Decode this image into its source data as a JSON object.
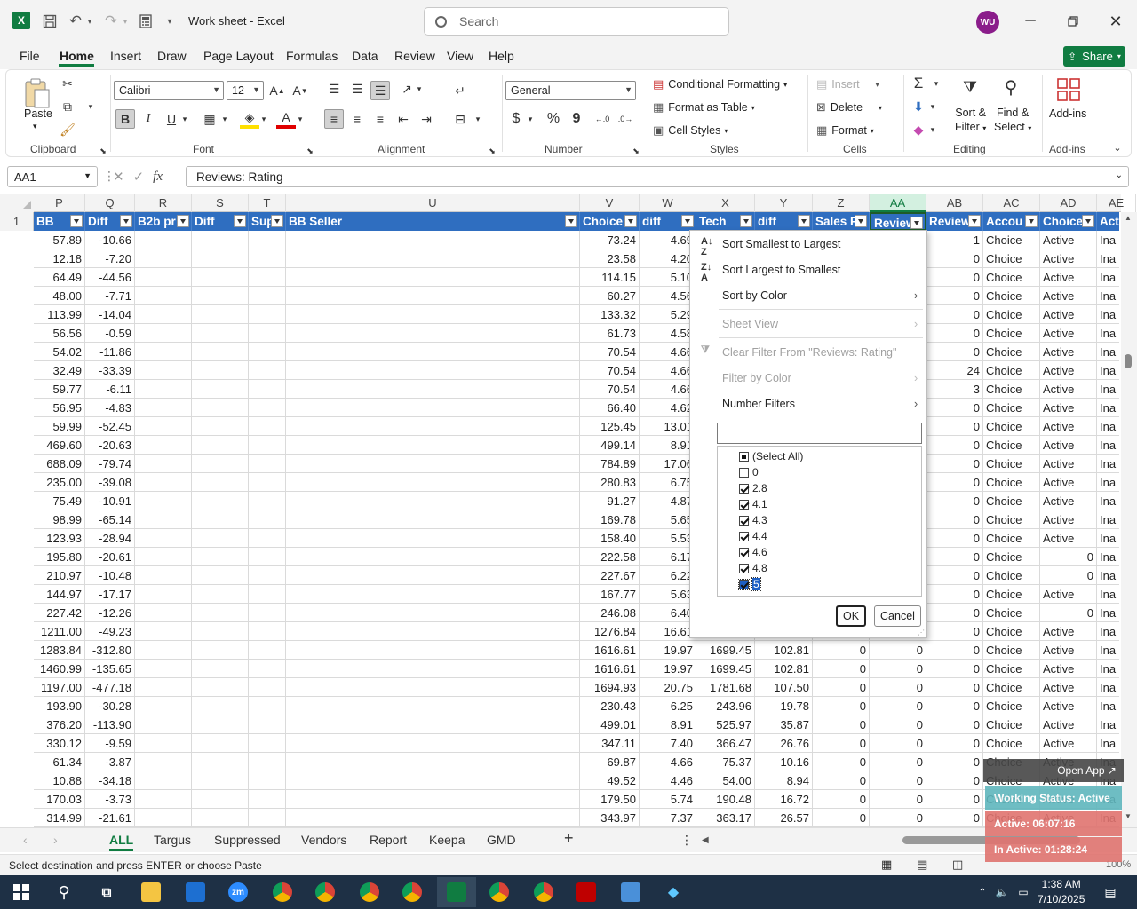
{
  "titlebar": {
    "app_logo": "X",
    "title": "Work sheet  -  Excel",
    "search_placeholder": "Search",
    "avatar": "WU",
    "icons": [
      "save-icon",
      "undo-icon",
      "redo-icon",
      "calculator-icon",
      "customize-icon",
      "minimize-icon",
      "restore-icon",
      "close-icon"
    ]
  },
  "menu": {
    "items": [
      "File",
      "Home",
      "Insert",
      "Draw",
      "Page Layout",
      "Formulas",
      "Data",
      "Review",
      "View",
      "Help"
    ],
    "active": "Home",
    "share": "Share"
  },
  "ribbon": {
    "clipboard": {
      "paste": "Paste",
      "label": "Clipboard"
    },
    "font": {
      "name": "Calibri",
      "size": "12",
      "label": "Font",
      "bold": "B",
      "italic": "I",
      "underline": "U"
    },
    "alignment": {
      "label": "Alignment"
    },
    "number": {
      "format": "General",
      "label": "Number",
      "currency": "$",
      "percent": "%",
      "comma": "9"
    },
    "styles": {
      "conditional": "Conditional Formatting",
      "table": "Format as Table",
      "cell": "Cell Styles",
      "label": "Styles"
    },
    "cells": {
      "insert": "Insert",
      "delete": "Delete",
      "format": "Format",
      "label": "Cells"
    },
    "editing": {
      "sort": "Sort &",
      "sort2": "Filter",
      "find": "Find &",
      "find2": "Select",
      "label": "Editing"
    },
    "addins": {
      "btn": "Add-ins",
      "label": "Add-ins"
    }
  },
  "formula_bar": {
    "name_box": "AA1",
    "formula": "Reviews: Rating",
    "fx": "fx"
  },
  "columns": [
    "P",
    "Q",
    "R",
    "S",
    "T",
    "U",
    "V",
    "W",
    "X",
    "Y",
    "Z",
    "AA",
    "AB",
    "AC",
    "AD",
    "AE"
  ],
  "row1": "1",
  "headers": [
    "BB",
    "Diff",
    "B2b pr",
    "Diff",
    "Sup",
    "BB Seller",
    "Choice",
    "diff",
    "Tech",
    "diff",
    "Sales F",
    "Review",
    "Review",
    "Accou",
    "Choice",
    "Act"
  ],
  "rows": [
    [
      "57.89",
      "-10.66",
      "",
      "",
      "",
      "",
      "73.24",
      "4.69",
      "",
      "",
      "",
      "",
      "1",
      "Choice",
      "Active",
      "Ina"
    ],
    [
      "12.18",
      "-7.20",
      "",
      "",
      "",
      "",
      "23.58",
      "4.20",
      "",
      "",
      "",
      "",
      "0",
      "Choice",
      "Active",
      "Ina"
    ],
    [
      "64.49",
      "-44.56",
      "",
      "",
      "",
      "",
      "114.15",
      "5.10",
      "",
      "",
      "",
      "",
      "0",
      "Choice",
      "Active",
      "Ina"
    ],
    [
      "48.00",
      "-7.71",
      "",
      "",
      "",
      "",
      "60.27",
      "4.56",
      "",
      "",
      "",
      "",
      "0",
      "Choice",
      "Active",
      "Ina"
    ],
    [
      "113.99",
      "-14.04",
      "",
      "",
      "",
      "",
      "133.32",
      "5.29",
      "",
      "",
      "",
      "",
      "0",
      "Choice",
      "Active",
      "Ina"
    ],
    [
      "56.56",
      "-0.59",
      "",
      "",
      "",
      "",
      "61.73",
      "4.58",
      "",
      "",
      "",
      "",
      "0",
      "Choice",
      "Active",
      "Ina"
    ],
    [
      "54.02",
      "-11.86",
      "",
      "",
      "",
      "",
      "70.54",
      "4.66",
      "",
      "",
      "",
      "",
      "0",
      "Choice",
      "Active",
      "Ina"
    ],
    [
      "32.49",
      "-33.39",
      "",
      "",
      "",
      "",
      "70.54",
      "4.66",
      "",
      "",
      "",
      "",
      "24",
      "Choice",
      "Active",
      "Ina"
    ],
    [
      "59.77",
      "-6.11",
      "",
      "",
      "",
      "",
      "70.54",
      "4.66",
      "",
      "",
      "",
      "",
      "3",
      "Choice",
      "Active",
      "Ina"
    ],
    [
      "56.95",
      "-4.83",
      "",
      "",
      "",
      "",
      "66.40",
      "4.62",
      "",
      "",
      "",
      "",
      "0",
      "Choice",
      "Active",
      "Ina"
    ],
    [
      "59.99",
      "-52.45",
      "",
      "",
      "",
      "",
      "125.45",
      "13.01",
      "",
      "",
      "",
      "",
      "0",
      "Choice",
      "Active",
      "Ina"
    ],
    [
      "469.60",
      "-20.63",
      "",
      "",
      "",
      "",
      "499.14",
      "8.91",
      "",
      "",
      "",
      "",
      "0",
      "Choice",
      "Active",
      "Ina"
    ],
    [
      "688.09",
      "-79.74",
      "",
      "",
      "",
      "",
      "784.89",
      "17.06",
      "",
      "",
      "",
      "",
      "0",
      "Choice",
      "Active",
      "Ina"
    ],
    [
      "235.00",
      "-39.08",
      "",
      "",
      "",
      "",
      "280.83",
      "6.75",
      "",
      "",
      "",
      "",
      "0",
      "Choice",
      "Active",
      "Ina"
    ],
    [
      "75.49",
      "-10.91",
      "",
      "",
      "",
      "",
      "91.27",
      "4.87",
      "",
      "",
      "",
      "",
      "0",
      "Choice",
      "Active",
      "Ina"
    ],
    [
      "98.99",
      "-65.14",
      "",
      "",
      "",
      "",
      "169.78",
      "5.65",
      "",
      "",
      "",
      "",
      "0",
      "Choice",
      "Active",
      "Ina"
    ],
    [
      "123.93",
      "-28.94",
      "",
      "",
      "",
      "",
      "158.40",
      "5.53",
      "",
      "",
      "",
      "",
      "0",
      "Choice",
      "Active",
      "Ina"
    ],
    [
      "195.80",
      "-20.61",
      "",
      "",
      "",
      "",
      "222.58",
      "6.17",
      "",
      "",
      "",
      "",
      "0",
      "Choice",
      "0",
      "Ina"
    ],
    [
      "210.97",
      "-10.48",
      "",
      "",
      "",
      "",
      "227.67",
      "6.22",
      "",
      "",
      "",
      "",
      "0",
      "Choice",
      "0",
      "Ina"
    ],
    [
      "144.97",
      "-17.17",
      "",
      "",
      "",
      "",
      "167.77",
      "5.63",
      "",
      "",
      "",
      "",
      "0",
      "Choice",
      "Active",
      "Ina"
    ],
    [
      "227.42",
      "-12.26",
      "",
      "",
      "",
      "",
      "246.08",
      "6.40",
      "",
      "",
      "",
      "",
      "0",
      "Choice",
      "0",
      "Ina"
    ],
    [
      "1211.00",
      "-49.23",
      "",
      "",
      "",
      "",
      "1276.84",
      "16.61",
      "",
      "",
      "",
      "",
      "0",
      "Choice",
      "Active",
      "Ina"
    ],
    [
      "1283.84",
      "-312.80",
      "",
      "",
      "",
      "",
      "1616.61",
      "19.97",
      "1699.45",
      "102.81",
      "0",
      "0",
      "0",
      "Choice",
      "Active",
      "Ina"
    ],
    [
      "1460.99",
      "-135.65",
      "",
      "",
      "",
      "",
      "1616.61",
      "19.97",
      "1699.45",
      "102.81",
      "0",
      "0",
      "0",
      "Choice",
      "Active",
      "Ina"
    ],
    [
      "1197.00",
      "-477.18",
      "",
      "",
      "",
      "",
      "1694.93",
      "20.75",
      "1781.68",
      "107.50",
      "0",
      "0",
      "0",
      "Choice",
      "Active",
      "Ina"
    ],
    [
      "193.90",
      "-30.28",
      "",
      "",
      "",
      "",
      "230.43",
      "6.25",
      "243.96",
      "19.78",
      "0",
      "0",
      "0",
      "Choice",
      "Active",
      "Ina"
    ],
    [
      "376.20",
      "-113.90",
      "",
      "",
      "",
      "",
      "499.01",
      "8.91",
      "525.97",
      "35.87",
      "0",
      "0",
      "0",
      "Choice",
      "Active",
      "Ina"
    ],
    [
      "330.12",
      "-9.59",
      "",
      "",
      "",
      "",
      "347.11",
      "7.40",
      "366.47",
      "26.76",
      "0",
      "0",
      "0",
      "Choice",
      "Active",
      "Ina"
    ],
    [
      "61.34",
      "-3.87",
      "",
      "",
      "",
      "",
      "69.87",
      "4.66",
      "75.37",
      "10.16",
      "0",
      "0",
      "0",
      "Choice",
      "Active",
      "Ina"
    ],
    [
      "10.88",
      "-34.18",
      "",
      "",
      "",
      "",
      "49.52",
      "4.46",
      "54.00",
      "8.94",
      "0",
      "0",
      "0",
      "Choice",
      "Active",
      "Ina"
    ],
    [
      "170.03",
      "-3.73",
      "",
      "",
      "",
      "",
      "179.50",
      "5.74",
      "190.48",
      "16.72",
      "0",
      "0",
      "0",
      "Choice",
      "Active",
      "Ina"
    ],
    [
      "314.99",
      "-21.61",
      "",
      "",
      "",
      "",
      "343.97",
      "7.37",
      "363.17",
      "26.57",
      "0",
      "0",
      "0",
      "Choice",
      "Active",
      "Ina"
    ]
  ],
  "filter_menu": {
    "sort_asc": "Sort Smallest to Largest",
    "sort_desc": "Sort Largest to Smallest",
    "sort_color": "Sort by Color",
    "sheet_view": "Sheet View",
    "clear_filter": "Clear Filter From \"Reviews: Rating\"",
    "filter_color": "Filter by Color",
    "number_filters": "Number Filters",
    "list": [
      {
        "label": "(Select All)",
        "state": "partial"
      },
      {
        "label": "0",
        "state": "off"
      },
      {
        "label": "2.8",
        "state": "on"
      },
      {
        "label": "4.1",
        "state": "on"
      },
      {
        "label": "4.3",
        "state": "on"
      },
      {
        "label": "4.4",
        "state": "on"
      },
      {
        "label": "4.6",
        "state": "on"
      },
      {
        "label": "4.8",
        "state": "on"
      },
      {
        "label": "5",
        "state": "on"
      }
    ],
    "ok": "OK",
    "cancel": "Cancel"
  },
  "sheet_tabs": [
    "ALL",
    "Targus",
    "Suppressed",
    "Vendors",
    "Report",
    "Keepa",
    "GMD"
  ],
  "active_tab": "ALL",
  "status": {
    "text": "Select destination and press ENTER or choose Paste",
    "zoom": "100%"
  },
  "overlay": {
    "open_app": "Open App ↗",
    "working": "Working Status: Active",
    "active": "Active: 06:07:16",
    "inactive": "In Active: 01:28:24"
  },
  "taskbar": {
    "time": "1:38 AM",
    "date": "7/10/2025"
  },
  "colors": {
    "excel_green": "#107c41",
    "header_blue": "#2f6ec0"
  }
}
